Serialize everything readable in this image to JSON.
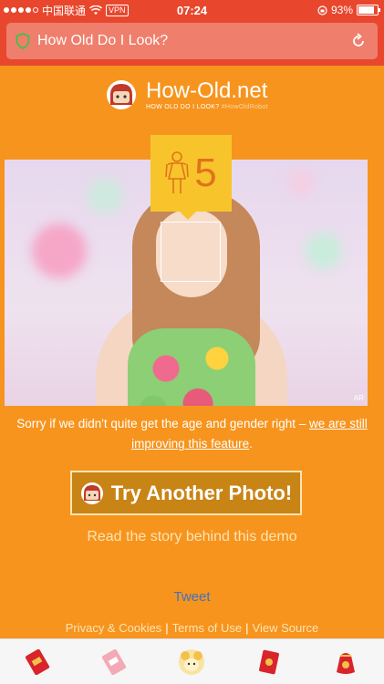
{
  "status_bar": {
    "carrier": "中国联通",
    "vpn_label": "VPN",
    "time": "07:24",
    "battery": "93%"
  },
  "browser": {
    "url_text": "How Old Do I Look?"
  },
  "logo": {
    "title": "How-Old.net",
    "tagline": "HOW OLD DO I LOOK?",
    "handle": "#HowOldRobot"
  },
  "result": {
    "gender": "female",
    "age": "5"
  },
  "photo": {
    "watermark": "AR"
  },
  "message": {
    "sorry_text": "Sorry if we didn't quite get the age and gender right – ",
    "sorry_link": "we are still improving this feature",
    "sorry_end": "."
  },
  "actions": {
    "try_another": "Try Another Photo!",
    "story_link": "Read the story behind this demo",
    "tweet": "Tweet"
  },
  "footer": {
    "privacy": "Privacy & Cookies",
    "terms": "Terms of Use",
    "source": "View Source",
    "separator": "|"
  },
  "colors": {
    "background": "#f7941e",
    "status_bar": "#e8472e",
    "badge": "#f7c52b",
    "button": "#c98416",
    "tweet_link": "#3f73c2"
  }
}
